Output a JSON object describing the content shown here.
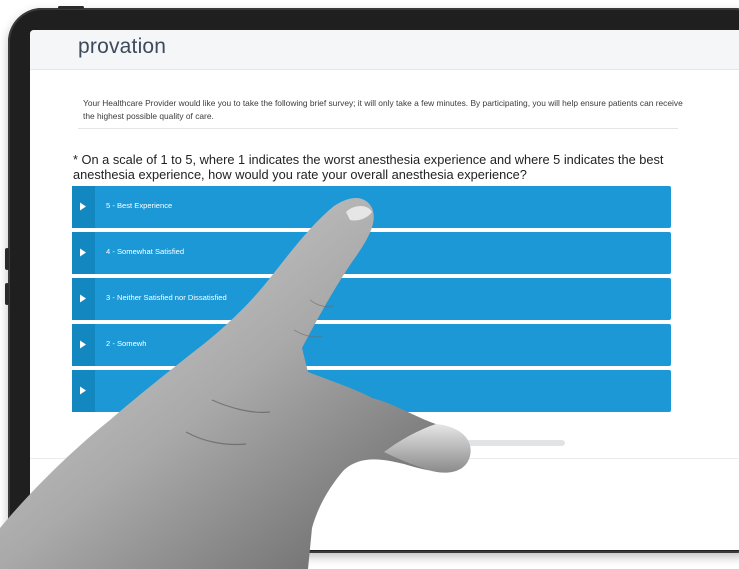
{
  "brand": {
    "logo_text": "provation"
  },
  "survey": {
    "intro": "Your Healthcare Provider would like you to take the following brief survey; it will only take a few minutes. By participating, you will help ensure patients can receive the highest possible quality of care.",
    "question": "* On a scale of 1 to 5, where 1 indicates the worst anesthesia experience and where 5 indicates the best anesthesia experience, how would you rate your overall anesthesia experience?",
    "options": [
      {
        "label": "5 - Best Experience"
      },
      {
        "label": "4 - Somewhat Satisfied"
      },
      {
        "label": "3 - Neither Satisfied nor Dissatisfied"
      },
      {
        "label": "2 - Somewh"
      },
      {
        "label": ""
      }
    ]
  },
  "colors": {
    "option_bg": "#1b98d5",
    "option_tab": "#1388c0",
    "logo": "#3d4a5c"
  },
  "icons": {
    "option_icon": "chevron-right-icon"
  }
}
